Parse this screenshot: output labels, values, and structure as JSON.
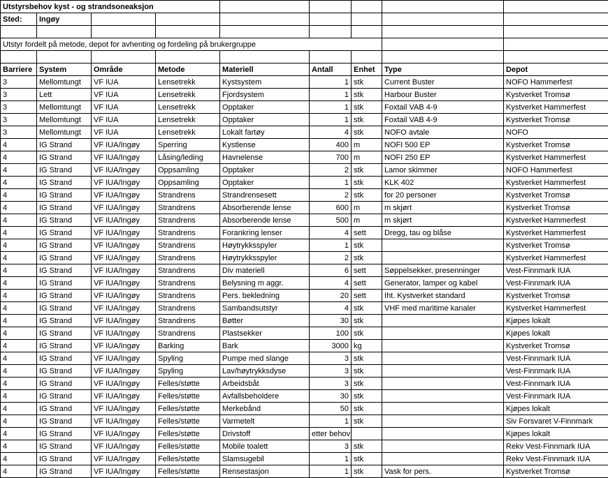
{
  "title": "Utstyrsbehov kyst - og strandsoneaksjon",
  "sted_label": "Sted:",
  "sted_value": "Ingøy",
  "subtitle": "Utstyr fordelt på metode, depot for avhenting og fordeling på brukergruppe",
  "headers": [
    "Barriere",
    "System",
    "Område",
    "Metode",
    "Materiell",
    "Antall",
    "Enhet",
    "Type",
    "Depot"
  ],
  "rows": [
    [
      "3",
      "Mellomtungt",
      "VF IUA",
      "Lensetrekk",
      "Kystsystem",
      "1",
      "stk",
      "Current Buster",
      "NOFO Hammerfest"
    ],
    [
      "3",
      "Lett",
      "VF IUA",
      "Lensetrekk",
      "Fjordsystem",
      "1",
      "stk",
      "Harbour Buster",
      "Kystverket Tromsø"
    ],
    [
      "3",
      "Mellomtungt",
      "VF IUA",
      "Lensetrekk",
      "Opptaker",
      "1",
      "stk",
      "Foxtail VAB 4-9",
      "Kystverket Hammerfest"
    ],
    [
      "3",
      "Mellomtungt",
      "VF IUA",
      "Lensetrekk",
      "Opptaker",
      "1",
      "stk",
      "Foxtail VAB 4-9",
      "Kystverket Tromsø"
    ],
    [
      "3",
      "Mellomtungt",
      "VF IUA",
      "Lensetrekk",
      "Lokalt fartøy",
      "4",
      "stk",
      "NOFO avtale",
      "NOFO"
    ],
    [
      "4",
      "IG Strand",
      "VF IUA/Ingøy",
      "Sperring",
      "Kystlense",
      "400",
      "m",
      "NOFI 500 EP",
      "Kystverket Tromsø"
    ],
    [
      "4",
      "IG Strand",
      "VF IUA/Ingøy",
      "Låsing/leding",
      "Havnelense",
      "700",
      "m",
      "NOFI 250 EP",
      "Kystverket Hammerfest"
    ],
    [
      "4",
      "IG Strand",
      "VF IUA/Ingøy",
      "Oppsamling",
      "Opptaker",
      "2",
      "stk",
      "Lamor skimmer",
      "NOFO Hammerfest"
    ],
    [
      "4",
      "IG Strand",
      "VF IUA/Ingøy",
      "Oppsamling",
      "Opptaker",
      "1",
      "stk",
      "KLK 402",
      "Kystverket Hammerfest"
    ],
    [
      "4",
      "IG Strand",
      "VF IUA/Ingøy",
      "Strandrens",
      "Strandrensesett",
      "2",
      "stk",
      "for 20 personer",
      "Kystverket Tromsø"
    ],
    [
      "4",
      "IG Strand",
      "VF IUA/Ingøy",
      "Strandrens",
      "Absorberende lense",
      "600",
      "m",
      "m skjørt",
      "Kystverket Tromsø"
    ],
    [
      "4",
      "IG Strand",
      "VF IUA/Ingøy",
      "Strandrens",
      "Absorberende lense",
      "500",
      "m",
      "m skjørt",
      "Kystverket Hammerfest"
    ],
    [
      "4",
      "IG Strand",
      "VF IUA/Ingøy",
      "Strandrens",
      "Forankring lenser",
      "4",
      "sett",
      "Dregg, tau og blåse",
      "Kystverket Hammerfest"
    ],
    [
      "4",
      "IG Strand",
      "VF IUA/Ingøy",
      "Strandrens",
      "Høytrykksspyler",
      "1",
      "stk",
      "",
      "Kystverket Tromsø"
    ],
    [
      "4",
      "IG Strand",
      "VF IUA/Ingøy",
      "Strandrens",
      "Høytrykksspyler",
      "2",
      "stk",
      "",
      "Kystverket Hammerfest"
    ],
    [
      "4",
      "IG Strand",
      "VF IUA/Ingøy",
      "Strandrens",
      "Div materiell",
      "6",
      "sett",
      "Søppelsekker, presenninger",
      "Vest-Finnmark IUA"
    ],
    [
      "4",
      "IG Strand",
      "VF IUA/Ingøy",
      "Strandrens",
      "Belysning m aggr.",
      "4",
      "sett",
      "Generator, lamper og kabel",
      "Vest-Finnmark IUA"
    ],
    [
      "4",
      "IG Strand",
      "VF IUA/Ingøy",
      "Strandrens",
      "Pers. bekledning",
      "20",
      "sett",
      "Iht. Kystverket standard",
      "Kystverket Tromsø"
    ],
    [
      "4",
      "IG Strand",
      "VF IUA/Ingøy",
      "Strandrens",
      "Sambandsutstyr",
      "4",
      "stk",
      "VHF med maritime kanaler",
      "Kystverket Hammerfest"
    ],
    [
      "4",
      "IG Strand",
      "VF IUA/Ingøy",
      "Strandrens",
      "Bøtter",
      "30",
      "stk",
      "",
      "Kjøpes lokalt"
    ],
    [
      "4",
      "IG Strand",
      "VF IUA/Ingøy",
      "Strandrens",
      "Plastsekker",
      "100",
      "stk",
      "",
      "Kjøpes lokalt"
    ],
    [
      "4",
      "IG Strand",
      "VF IUA/Ingøy",
      "Barking",
      "Bark",
      "3000",
      "kg",
      "",
      "Kystverket Tromsø"
    ],
    [
      "4",
      "IG Strand",
      "VF IUA/Ingøy",
      "Spyling",
      "Pumpe med slange",
      "3",
      "stk",
      "",
      "Vest-Finnmark IUA"
    ],
    [
      "4",
      "IG Strand",
      "VF IUA/Ingøy",
      "Spyling",
      "Lav/høytrykksdyse",
      "3",
      "stk",
      "",
      "Vest-Finnmark IUA"
    ],
    [
      "4",
      "IG Strand",
      "VF IUA/Ingøy",
      "Felles/støtte",
      "Arbeidsbåt",
      "3",
      "stk",
      "",
      "Vest-Finnmark IUA"
    ],
    [
      "4",
      "IG Strand",
      "VF IUA/Ingøy",
      "Felles/støtte",
      "Avfallsbeholdere",
      "30",
      "stk",
      "",
      "Vest-Finnmark IUA"
    ],
    [
      "4",
      "IG Strand",
      "VF IUA/Ingøy",
      "Felles/støtte",
      "Merkebånd",
      "50",
      "stk",
      "",
      "Kjøpes lokalt"
    ],
    [
      "4",
      "IG Strand",
      "VF IUA/Ingøy",
      "Felles/støtte",
      "Varmetelt",
      "1",
      "stk",
      "",
      "Siv Forsvaret V-Finnmark"
    ],
    [
      "4",
      "IG Strand",
      "VF IUA/Ingøy",
      "Felles/støtte",
      "Drivstoff",
      "etter behov",
      "",
      "",
      "Kjøpes lokalt"
    ],
    [
      "4",
      "IG Strand",
      "VF IUA/Ingøy",
      "Felles/støtte",
      "Mobile toalett",
      "3",
      "stk",
      "",
      "Rekv Vest-Finnmark IUA"
    ],
    [
      "4",
      "IG Strand",
      "VF IUA/Ingøy",
      "Felles/støtte",
      "Slamsugebil",
      "1",
      "stk",
      "",
      "Rekv Vest-Finnmark IUA"
    ],
    [
      "4",
      "IG Strand",
      "VF IUA/Ingøy",
      "Felles/støtte",
      "Rensestasjon",
      "1",
      "stk",
      "Vask for pers.",
      "Kystverket Tromsø"
    ]
  ],
  "antall_col_index": 5,
  "special_antall_text": "etter behov"
}
